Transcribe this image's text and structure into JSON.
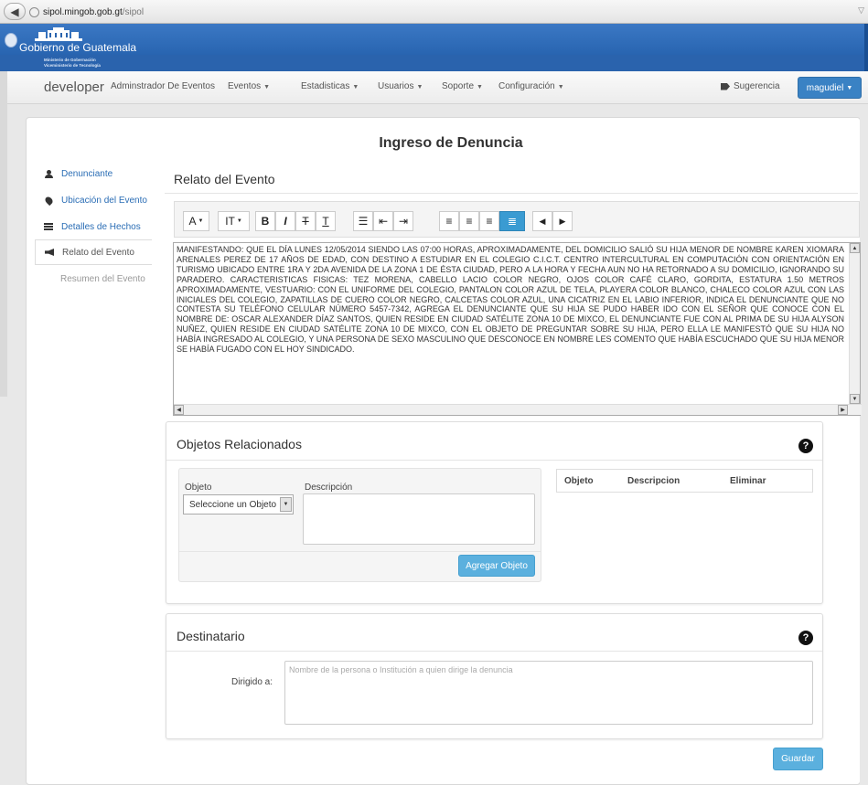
{
  "browser": {
    "url_domain": "sipol.mingob.gob.gt",
    "url_path": "/sipol"
  },
  "banner": {
    "brand": "Gobierno de Guatemala",
    "sub1": "Ministerio de Gobernación",
    "sub2": "Viceministerio de Tecnología"
  },
  "navbar": {
    "brand": "developer",
    "items": [
      "Adminstrador De Eventos",
      "Eventos",
      "Estadisticas",
      "Usuarios",
      "Soporte",
      "Configuración"
    ],
    "suggestion": "Sugerencia",
    "user": "magudiel"
  },
  "page": {
    "title": "Ingreso de Denuncia"
  },
  "sidenav": {
    "items": [
      "Denunciante",
      "Ubicación del Evento",
      "Detalles de Hechos",
      "Relato del Evento",
      "Resumen del Evento"
    ]
  },
  "relato": {
    "heading": "Relato del Evento",
    "toolbar": {
      "font": "A",
      "size": "IT",
      "bold": "B",
      "italic": "I",
      "strike": "T",
      "underline": "T",
      "undo": "◀",
      "redo": "▶"
    },
    "text": "MANIFESTANDO: QUE EL DÍA LUNES 12/05/2014 SIENDO LAS 07:00 HORAS, APROXIMADAMENTE, DEL DOMICILIO SALIÓ SU HIJA MENOR DE NOMBRE KAREN XIOMARA ARENALES PEREZ DE 17 AÑOS DE EDAD, CON DESTINO A ESTUDIAR EN EL COLEGIO C.I.C.T. CENTRO INTERCULTURAL EN COMPUTACIÓN CON ORIENTACIÓN EN TURISMO UBICADO ENTRE 1RA Y 2DA AVENIDA DE LA ZONA 1 DE ÉSTA CIUDAD, PERO A LA HORA Y FECHA AUN NO HA RETORNADO A SU DOMICILIO, IGNORANDO SU PARADERO.  CARACTERISTICAS FISICAS: TEZ MORENA, CABELLO LACIO COLOR NEGRO, OJOS COLOR CAFÉ CLARO, GORDITA, ESTATURA 1.50 METROS APROXIMADAMENTE, VESTUARIO: CON EL UNIFORME DEL COLEGIO, PANTALON COLOR AZUL DE TELA, PLAYERA COLOR BLANCO, CHALECO COLOR AZUL CON LAS INICIALES DEL COLEGIO, ZAPATILLAS DE CUERO COLOR NEGRO, CALCETAS COLOR AZUL, UNA CICATRIZ EN EL LABIO INFERIOR, INDICA EL DENUNCIANTE QUE NO CONTESTA SU TELÉFONO CELULAR NÚMERO 5457-7342, AGREGA EL DENUNCIANTE QUE SU HIJA SE PUDO HABER IDO CON EL SEÑOR QUE CONOCE CON EL NOMBRE DE: OSCAR ALEXANDER DÍAZ SANTOS, QUIEN RESIDE EN CIUDAD SATÉLITE ZONA 10 DE MIXCO, EL DENUNCIANTE FUE CON AL PRIMA DE SU HIJA ALYSON NUÑEZ, QUIEN RESIDE EN CIUDAD SATÉLITE ZONA 10 DE MIXCO, CON EL OBJETO DE PREGUNTAR SOBRE SU HIJA, PERO ELLA LE MANIFESTÓ QUE SU HIJA NO HABÍA INGRESADO AL COLEGIO, Y UNA PERSONA DE SEXO MASCULINO QUE DESCONOCE EN NOMBRE LES COMENTO QUE HABÍA ESCUCHADO QUE SU HIJA MENOR SE HABÍA FUGADO CON EL HOY SINDICADO."
  },
  "objetos": {
    "heading": "Objetos Relacionados",
    "help": "?",
    "objeto_label": "Objeto",
    "descripcion_label": "Descripción",
    "select_value": "Seleccione un Objeto",
    "add_button": "Agregar Objeto",
    "table_headers": [
      "Objeto",
      "Descripcion",
      "Eliminar"
    ]
  },
  "destinatario": {
    "heading": "Destinatario",
    "help": "?",
    "label": "Dirigido a:",
    "placeholder": "Nombre de la persona o Institución a quien dirige la denuncia"
  },
  "actions": {
    "save": "Guardar"
  },
  "colors": {
    "primary": "#3a82c4",
    "info": "#5bb0de",
    "banner": "#1e5aa6",
    "link": "#2a6db5"
  }
}
